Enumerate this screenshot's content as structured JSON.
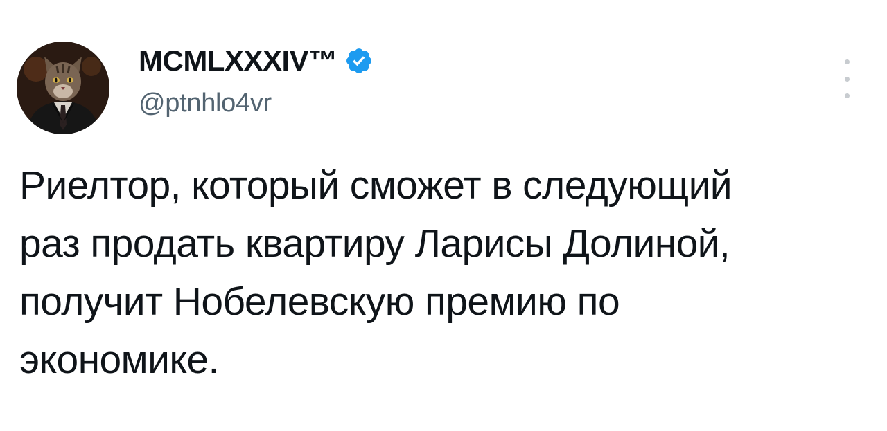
{
  "author": {
    "display_name": "MCMLXXXIV™",
    "handle": "@ptnhlo4vr",
    "verified": true,
    "verified_color": "#1d9bf0",
    "avatar": "cat-in-suit-avatar"
  },
  "more_menu": {
    "icon": "more-dots-vertical-icon"
  },
  "tweet": {
    "lines": [
      "Риелтор, который сможет в следующий",
      "раз продать квартиру Ларисы Долиной,",
      "получит Нобелевскую премию по",
      "экономике."
    ]
  }
}
